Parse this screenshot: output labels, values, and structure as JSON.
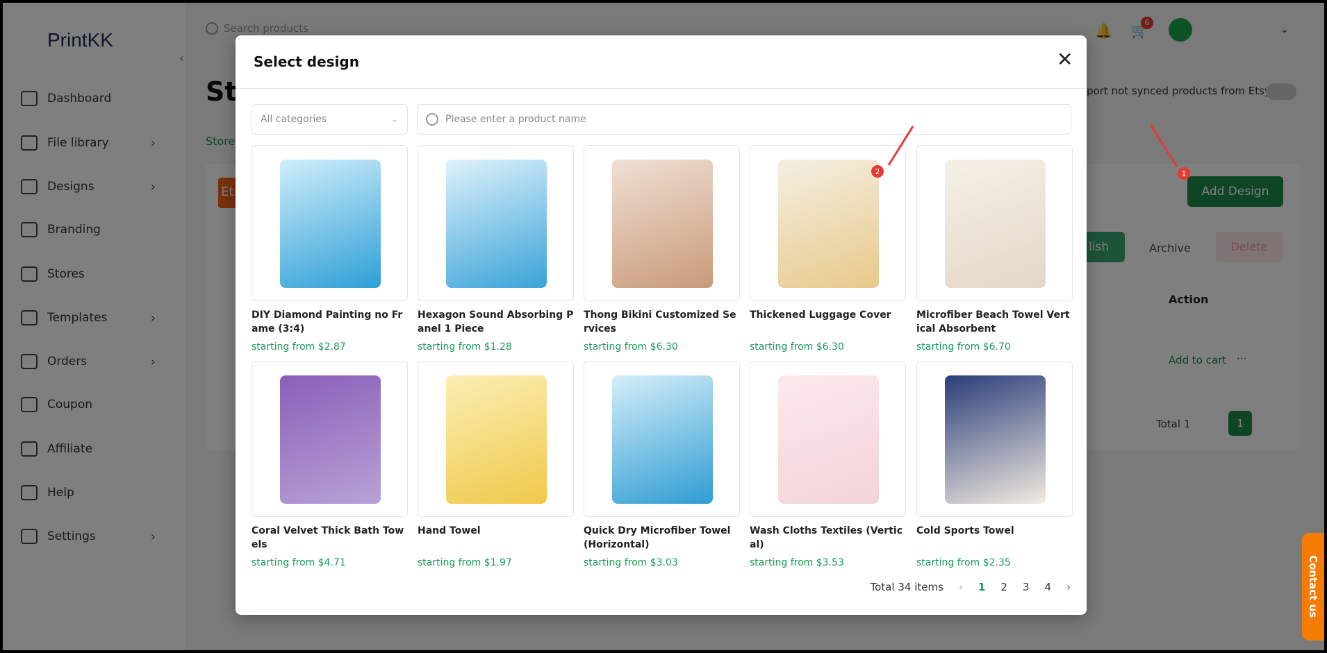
{
  "app": {
    "logo": "PrintKK",
    "search_placeholder": "Search products",
    "cart_count": "6"
  },
  "sidebar": {
    "items": [
      {
        "label": "Dashboard",
        "icon": "dashboard-icon",
        "chevron": false
      },
      {
        "label": "File library",
        "icon": "image-icon",
        "chevron": true
      },
      {
        "label": "Designs",
        "icon": "designs-icon",
        "chevron": true
      },
      {
        "label": "Branding",
        "icon": "tag-icon",
        "chevron": false
      },
      {
        "label": "Stores",
        "icon": "store-icon",
        "chevron": false
      },
      {
        "label": "Templates",
        "icon": "templates-icon",
        "chevron": true
      },
      {
        "label": "Orders",
        "icon": "orders-icon",
        "chevron": true
      },
      {
        "label": "Coupon",
        "icon": "coupon-icon",
        "chevron": false
      },
      {
        "label": "Affiliate",
        "icon": "affiliate-icon",
        "chevron": false
      },
      {
        "label": "Help",
        "icon": "help-icon",
        "chevron": false
      },
      {
        "label": "Settings",
        "icon": "gear-icon",
        "chevron": true
      }
    ]
  },
  "background": {
    "title": "Sto",
    "breadcrumb": "Store",
    "store_badge": "Et",
    "import_label": "port not synced products from Etsy",
    "add_design": "Add Design",
    "publish": "lish",
    "archive": "Archive",
    "delete": "Delete",
    "action_header": "Action",
    "add_to_cart": "Add to cart",
    "more": "···",
    "total": "Total 1",
    "page": "1",
    "contact": "Contact us"
  },
  "modal": {
    "title": "Select design",
    "category_select": "All categories",
    "search_placeholder": "Please enter a product name",
    "products": [
      {
        "name": "DIY Diamond Painting no Frame (3:4)",
        "price": "starting from $2.87",
        "colors": [
          "#2e9fd6",
          "#cfeefb"
        ]
      },
      {
        "name": "Hexagon Sound Absorbing Panel 1 Piece",
        "price": "starting from $1.28",
        "colors": [
          "#3aa3d8",
          "#dff2fb"
        ]
      },
      {
        "name": "Thong Bikini Customized Services",
        "price": "starting from $6.30",
        "colors": [
          "#c99a7a",
          "#f0e0d4"
        ]
      },
      {
        "name": "Thickened Luggage Cover",
        "price": "starting from $6.30",
        "colors": [
          "#e8c98a",
          "#f4efe3"
        ]
      },
      {
        "name": "Microfiber Beach Towel Vertical Absorbent",
        "price": "starting from $6.70",
        "colors": [
          "#e3d7c7",
          "#f6f0e7"
        ]
      },
      {
        "name": "Coral Velvet Thick Bath Towels",
        "price": "starting from $4.71",
        "colors": [
          "#b8a2d6",
          "#8a5fb8"
        ]
      },
      {
        "name": "Hand Towel",
        "price": "starting from $1.97",
        "colors": [
          "#f0c94a",
          "#fbeeb5"
        ]
      },
      {
        "name": "Quick Dry Microfiber Towel (Horizontal)",
        "price": "starting from $3.03",
        "colors": [
          "#2f9dd3",
          "#d5eef9"
        ]
      },
      {
        "name": "Wash Cloths Textiles (Vertical)",
        "price": "starting from $3.53",
        "colors": [
          "#f3d3d8",
          "#fbe9ec"
        ]
      },
      {
        "name": "Cold Sports Towel",
        "price": "starting from $2.35",
        "colors": [
          "#f2ebe0",
          "#2a3d7a"
        ]
      }
    ],
    "pagination": {
      "total": "Total 34 items",
      "pages": [
        "1",
        "2",
        "3",
        "4"
      ],
      "current": "1"
    }
  },
  "annotations": [
    "1",
    "2"
  ],
  "colors": {
    "accent": "#1a8a4a",
    "price": "#1a9a5a",
    "contact": "#f57c00",
    "annotation": "#e53935"
  }
}
